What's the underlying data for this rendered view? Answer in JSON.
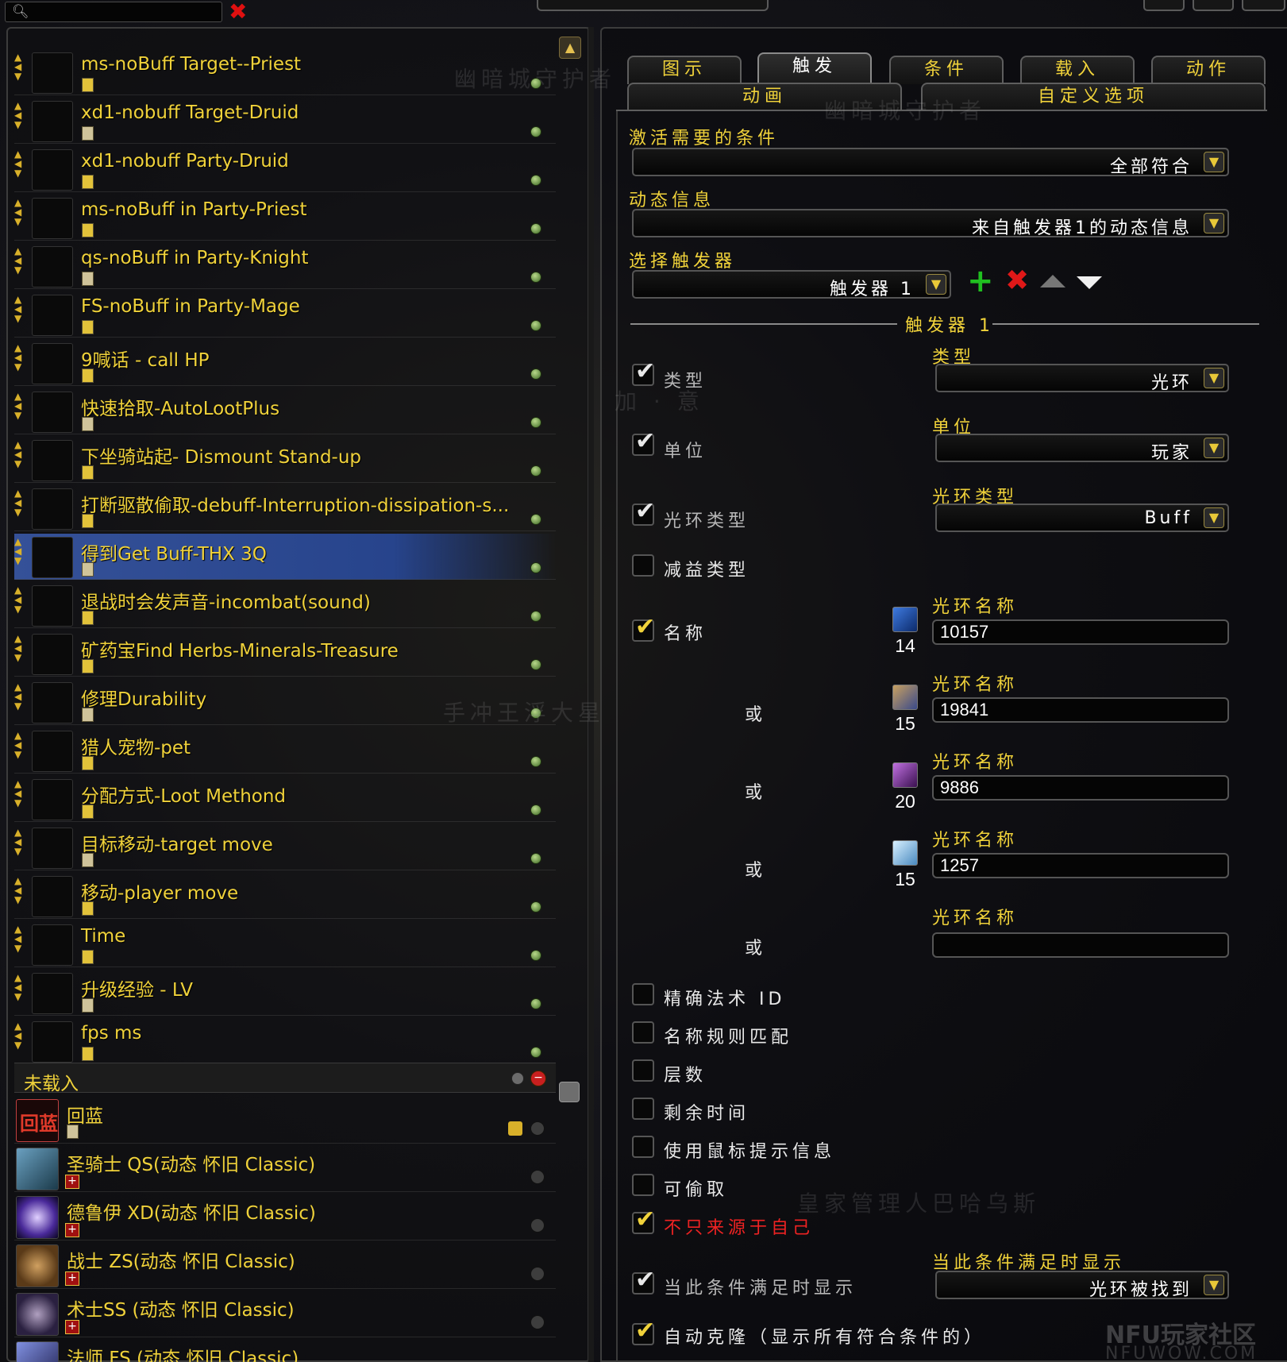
{
  "search": {
    "placeholder": "",
    "clear_glyph": "✖",
    "icon": "search-icon"
  },
  "auras": [
    {
      "name": "ms-noBuff Target--Priest"
    },
    {
      "name": "xd1-nobuff Target-Druid"
    },
    {
      "name": "xd1-nobuff Party-Druid"
    },
    {
      "name": "ms-noBuff in Party-Priest"
    },
    {
      "name": "qs-noBuff in Party-Knight"
    },
    {
      "name": "FS-noBuff in Party-Mage"
    },
    {
      "name": "9喊话 - call HP"
    },
    {
      "name": "快速拾取-AutoLootPlus"
    },
    {
      "name": "下坐骑站起- Dismount Stand-up"
    },
    {
      "name": "打断驱散偷取-debuff-Interruption-dissipation-s..."
    },
    {
      "name": "得到Get Buff-THX 3Q",
      "selected": true
    },
    {
      "name": "退战时会发声音-incombat(sound)"
    },
    {
      "name": "矿药宝Find Herbs-Minerals-Treasure"
    },
    {
      "name": "修理Durability"
    },
    {
      "name": "猎人宠物-pet"
    },
    {
      "name": "分配方式-Loot Methond"
    },
    {
      "name": "目标移动-target move"
    },
    {
      "name": "移动-player move"
    },
    {
      "name": "Time"
    },
    {
      "name": "升级经验 - LV"
    },
    {
      "name": "fps ms"
    }
  ],
  "unloaded_group": {
    "label": "未载入",
    "items": [
      {
        "name": "回蓝",
        "icon_text": "回蓝"
      },
      {
        "name": "圣骑士 QS(动态 怀旧 Classic)"
      },
      {
        "name": "德鲁伊 XD(动态 怀旧 Classic)"
      },
      {
        "name": "战士 ZS(动态 怀旧 Classic)"
      },
      {
        "name": "术士SS (动态 怀旧 Classic)"
      },
      {
        "name": "法师 FS (动态 怀旧 Classic)"
      }
    ]
  },
  "tabs": {
    "row1": [
      "图示",
      "触发",
      "条件",
      "载入",
      "动作"
    ],
    "row2": [
      "动画",
      "自定义选项"
    ],
    "active": "触发"
  },
  "trigger_settings": {
    "activation_label": "激活需要的条件",
    "activation_value": "全部符合",
    "dynamic_label": "动态信息",
    "dynamic_value": "来自触发器1的动态信息",
    "select_label": "选择触发器",
    "select_value": "触发器 1",
    "section_title": "触发器 1",
    "type_checkbox_label": "类型",
    "type_label": "类型",
    "type_value": "光环",
    "unit_checkbox_label": "单位",
    "unit_label": "单位",
    "unit_value": "玩家",
    "aura_type_checkbox_label": "光环类型",
    "aura_type_label": "光环类型",
    "aura_type_value": "Buff",
    "debuff_type_label": "减益类型",
    "name_checkbox_label": "名称",
    "aura_name_label": "光环名称",
    "or_label": "或",
    "aura_names": [
      {
        "value": "10157",
        "count": "14"
      },
      {
        "value": "19841",
        "count": "15"
      },
      {
        "value": "9886",
        "count": "20"
      },
      {
        "value": "1257",
        "count": "15"
      },
      {
        "value": "",
        "count": ""
      }
    ],
    "options": [
      {
        "label": "精确法术 ID",
        "checked": false
      },
      {
        "label": "名称规则匹配",
        "checked": false
      },
      {
        "label": "层数",
        "checked": false
      },
      {
        "label": "剩余时间",
        "checked": false
      },
      {
        "label": "使用鼠标提示信息",
        "checked": false
      },
      {
        "label": "可偷取",
        "checked": false
      },
      {
        "label": "不只来源于自己",
        "checked": true,
        "color": "#ee2222"
      }
    ],
    "show_when_checkbox_label": "当此条件满足时显示",
    "show_when_label": "当此条件满足时显示",
    "show_when_value": "光环被找到",
    "auto_clone_label": "自动克隆（显示所有符合条件的）"
  },
  "watermarks": [
    "幽暗城守护者",
    "幽暗城守护者",
    "手冲王浮大星",
    "皇家管理人巴哈乌斯",
    "加 · 意"
  ],
  "logo": {
    "main": "NFU玩家社区",
    "sub": "NFUWOW.COM"
  },
  "colors": {
    "accent_gold": "#f0d23a",
    "selected_row": "#2f4a94",
    "danger": "#e01818",
    "add": "#20c020"
  }
}
